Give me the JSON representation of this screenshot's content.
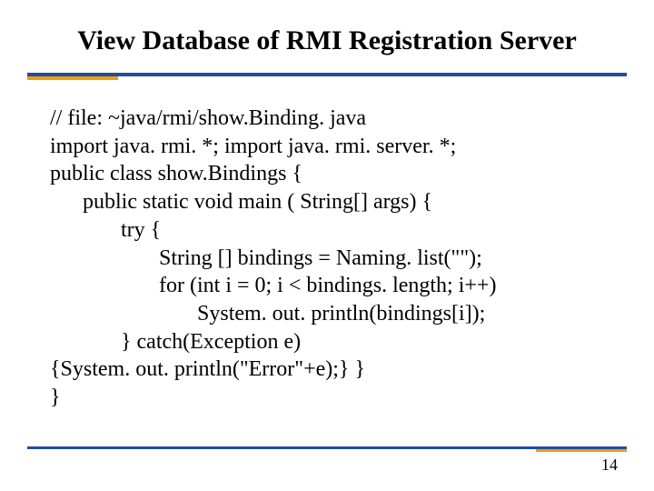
{
  "title": "View Database of RMI Registration Server",
  "code": {
    "l1": "// file: ~java/rmi/show.Binding. java",
    "l2": "import java. rmi. *; import java. rmi. server. *;",
    "l3": "public class show.Bindings {",
    "l4": "      public static void main ( String[] args) {",
    "l5": "             try {",
    "l6": "                    String [] bindings = Naming. list(\"\");",
    "l7": "                    for (int i = 0; i < bindings. length; i++)",
    "l8": "                           System. out. println(bindings[i]);",
    "l9": "             } catch(Exception e)",
    "l10": "{System. out. println(\"Error\"+e);} }",
    "l11": "}"
  },
  "page_number": "14"
}
